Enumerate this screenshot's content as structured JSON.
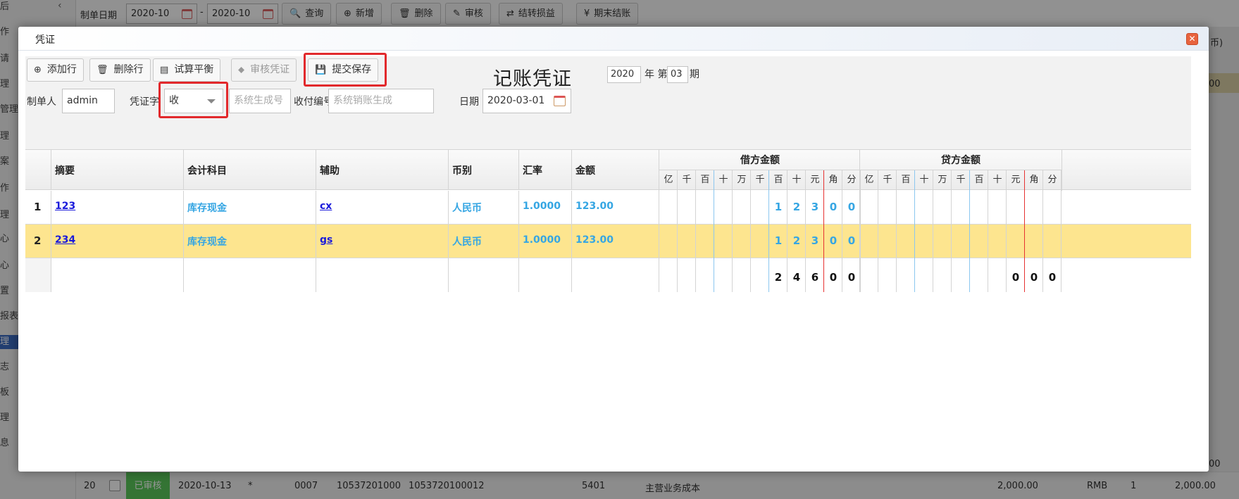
{
  "background": {
    "sidebar_items": [
      "后",
      "作",
      "请",
      "理",
      "管理",
      "理",
      "案",
      "作",
      "理",
      "心",
      "心",
      "置",
      "报表",
      "理",
      "志",
      "板",
      "理",
      "息"
    ],
    "active_index": 13,
    "collapse_glyph": "‹",
    "toolbar": {
      "date_label": "制单日期",
      "date_from": "2020-10",
      "date_sep": "-",
      "date_to": "2020-10",
      "buttons": [
        {
          "icon": "🔍",
          "label": "查询"
        },
        {
          "icon": "⊕",
          "label": "新增"
        },
        {
          "icon": "🗑",
          "label": "删除"
        },
        {
          "icon": "✎",
          "label": "审核"
        },
        {
          "icon": "⇄",
          "label": "结转损益"
        },
        {
          "icon": "¥",
          "label": "期末结账"
        }
      ]
    },
    "right_peek": [
      "币)",
      "00",
      "00"
    ],
    "row": {
      "no": "20",
      "status": "已审核",
      "date": "2020-10-13",
      "star": "*",
      "code": "0007",
      "num1": "10537201000",
      "num2": "1053720100012",
      "acct": "5401",
      "name": "主营业务成本",
      "amount": "2,000.00",
      "currency": "RMB",
      "qty": "1",
      "total": "2,000.00"
    }
  },
  "modal": {
    "title": "凭证",
    "close_glyph": "✕",
    "toolbar": [
      {
        "label": "添加行",
        "icon": "⊕",
        "disabled": false
      },
      {
        "label": "删除行",
        "icon": "🗑",
        "disabled": false
      },
      {
        "label": "试算平衡",
        "icon": "▤",
        "disabled": false
      },
      {
        "label": "审核凭证",
        "icon": "⬥",
        "disabled": true
      },
      {
        "label": "提交保存",
        "icon": "💾",
        "disabled": false
      }
    ],
    "voucher_title": "记账凭证",
    "year": "2020",
    "year_label": "年 第",
    "period": "03",
    "period_label": "期",
    "form": {
      "maker_label": "制单人",
      "maker_value": "admin",
      "type_label": "凭证字",
      "type_value": "收",
      "sysno_placeholder": "系统生成号",
      "payno_label": "收付编号",
      "payno_placeholder": "系统销账生成",
      "date_label": "日期",
      "date_value": "2020-03-01"
    },
    "grid": {
      "headers": [
        "摘要",
        "会计科目",
        "辅助",
        "币别",
        "汇率",
        "金额"
      ],
      "debit_title": "借方金额",
      "credit_title": "贷方金额",
      "digit_units": [
        "亿",
        "千",
        "百",
        "十",
        "万",
        "千",
        "百",
        "十",
        "元",
        "角",
        "分"
      ],
      "rows": [
        {
          "no": "1",
          "summary": "123",
          "account": "库存现金",
          "aux": "cx",
          "currency": "人民币",
          "rate": "1.0000",
          "amount": "123.00",
          "debit": [
            "",
            "",
            "",
            "",
            "",
            "",
            "1",
            "2",
            "3",
            "0",
            "0"
          ],
          "credit": [
            "",
            "",
            "",
            "",
            "",
            "",
            "",
            "",
            "",
            "",
            ""
          ],
          "highlight": false
        },
        {
          "no": "2",
          "summary": "234",
          "account": "库存现金",
          "aux": "gs",
          "currency": "人民币",
          "rate": "1.0000",
          "amount": "123.00",
          "debit": [
            "",
            "",
            "",
            "",
            "",
            "",
            "1",
            "2",
            "3",
            "0",
            "0"
          ],
          "credit": [
            "",
            "",
            "",
            "",
            "",
            "",
            "",
            "",
            "",
            "",
            ""
          ],
          "highlight": true
        }
      ],
      "total_debit": [
        "",
        "",
        "",
        "",
        "",
        "",
        "2",
        "4",
        "6",
        "0",
        "0"
      ],
      "total_credit": [
        "",
        "",
        "",
        "",
        "",
        "",
        "",
        "",
        "0",
        "0",
        "0"
      ]
    },
    "colors": {
      "accent_blue": "#36a6e3",
      "link": "#1a1adb",
      "highlight_row": "#fde58f",
      "red_outline": "#e2292c"
    }
  }
}
